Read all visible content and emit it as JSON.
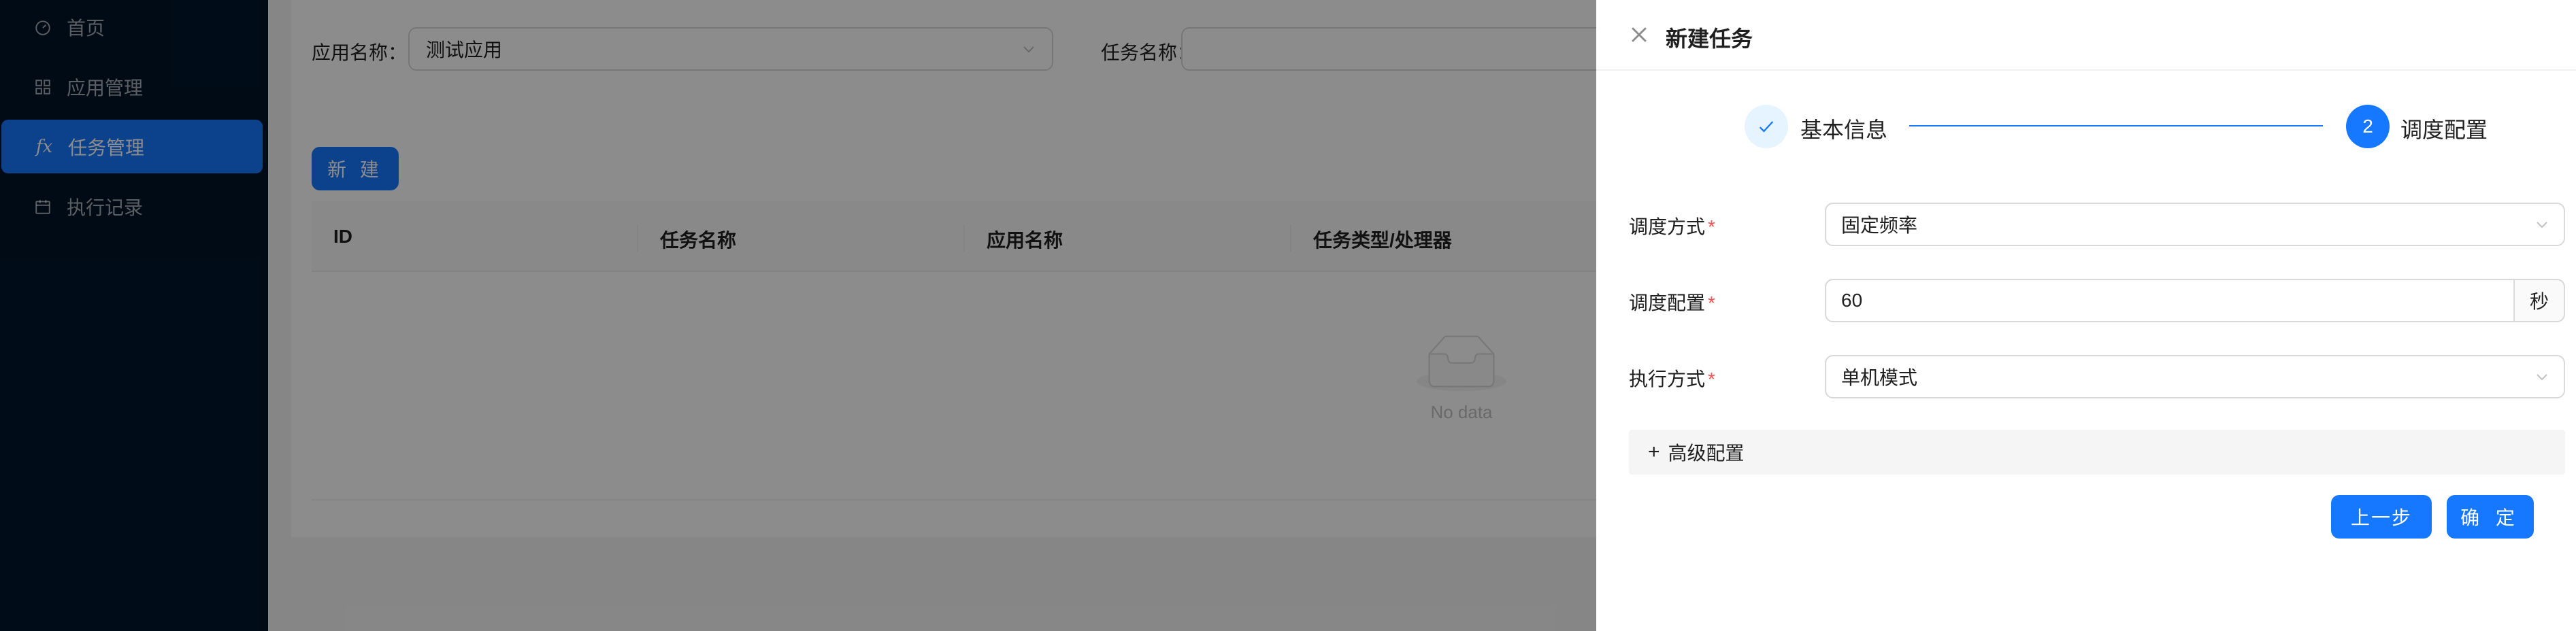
{
  "sidebar": {
    "items": [
      {
        "label": "首页",
        "icon": "dashboard-icon"
      },
      {
        "label": "应用管理",
        "icon": "appstore-icon"
      },
      {
        "label": "任务管理",
        "icon": "function-icon",
        "icon_text": "fx",
        "active": true
      },
      {
        "label": "执行记录",
        "icon": "calendar-icon"
      }
    ]
  },
  "filters": {
    "app_label": "应用名称：",
    "app_value": "测试应用",
    "task_label": "任务名称："
  },
  "toolbar": {
    "new_label": "新 建"
  },
  "table": {
    "columns": [
      "ID",
      "任务名称",
      "应用名称",
      "任务类型/处理器"
    ],
    "empty_text": "No data"
  },
  "drawer": {
    "title": "新建任务",
    "steps": [
      {
        "title": "基本信息",
        "status": "finish"
      },
      {
        "number": "2",
        "title": "调度配置",
        "status": "process"
      }
    ],
    "form": {
      "schedule_type_label": "调度方式",
      "schedule_type_value": "固定频率",
      "schedule_config_label": "调度配置",
      "schedule_config_value": "60",
      "schedule_config_unit": "秒",
      "exec_mode_label": "执行方式",
      "exec_mode_value": "单机模式",
      "required_mark": "*"
    },
    "advanced_label": "高级配置",
    "prev_label": "上一步",
    "ok_label": "确 定"
  },
  "colors": {
    "sidebar_bg": "#001529",
    "primary": "#1677ff",
    "required": "#ff4d4f",
    "mask": "rgba(0,0,0,0.45)"
  }
}
